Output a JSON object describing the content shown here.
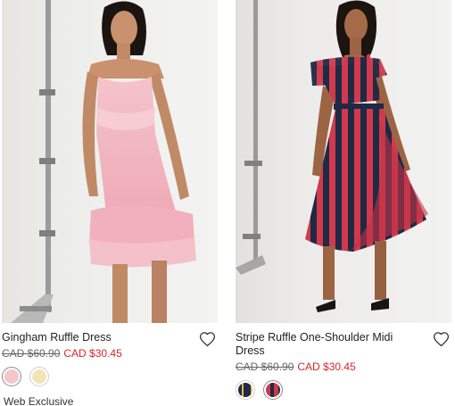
{
  "products": [
    {
      "name": "Gingham Ruffle Dress",
      "price_original": "CAD $60.90",
      "price_sale": "CAD $30.45",
      "swatch_colors": [
        "#f4c6cc",
        "#efe5b8"
      ],
      "badge": "Web Exclusive",
      "wishlist_icon": "heart-outline-icon"
    },
    {
      "name": "Stripe Ruffle One-Shoulder Midi Dress",
      "price_original": "CAD $60.90",
      "price_sale": "CAD $30.45",
      "swatch_colors": [
        "#1f2a44",
        "#c83a4a"
      ],
      "badge": "",
      "wishlist_icon": "heart-outline-icon"
    }
  ],
  "colors": {
    "sale_price": "#d9252b",
    "pink_dress": "#f2b8c2",
    "stripe_navy": "#1f2a44",
    "stripe_red": "#d2394c"
  }
}
